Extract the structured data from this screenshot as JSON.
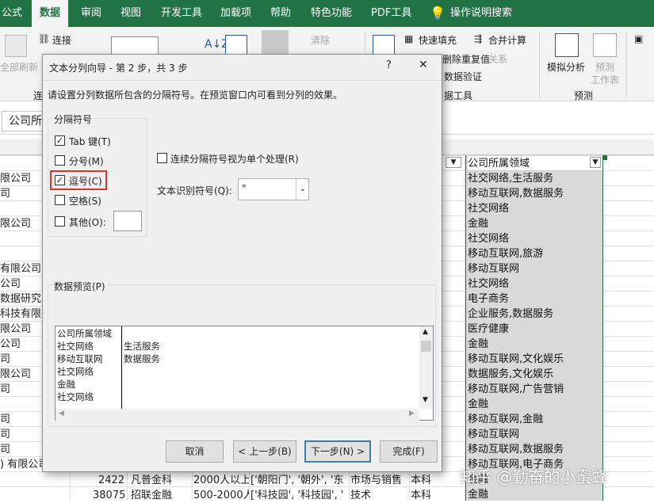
{
  "ribbon_tabs": [
    "公式",
    "数据",
    "审阅",
    "视图",
    "开发工具",
    "加载项",
    "帮助",
    "特色功能",
    "PDF工具",
    "操作说明搜索"
  ],
  "ribbon": {
    "connections": "连接",
    "refresh_all": "全部刷新",
    "clear": "清除",
    "flash_fill": "快速填充",
    "consolidate": "合并计算",
    "remove_dup": "删除重复值",
    "relations": "关系",
    "validate": "数据验证",
    "what_if": "模拟分析",
    "forecast_sheet": "预测\n工作表",
    "group_data_tools": "数据工具",
    "group_forecast": "预测",
    "group_conn_partial": "连",
    "group_tools_partial": "据工具"
  },
  "namebox": "公司所",
  "dialog": {
    "title": "文本分列向导 - 第 2 步，共 3 步",
    "help": "?",
    "close": "✕",
    "instruction": "请设置分列数据所包含的分隔符号。在预览窗口内可看到分列的效果。",
    "delimiters_label": "分隔符号",
    "opt_tab": "Tab 键(T)",
    "opt_semicolon": "分号(M)",
    "opt_comma": "逗号(C)",
    "opt_space": "空格(S)",
    "opt_other": "其他(O):",
    "consecutive": "连续分隔符号视为单个处理(R)",
    "text_qualifier_label": "文本识别符号(Q):",
    "text_qualifier_value": "\"",
    "preview_label": "数据预览(P)",
    "preview_rows": [
      [
        "公司所属领域",
        ""
      ],
      [
        "社交网络",
        "生活服务"
      ],
      [
        "移动互联网",
        "数据服务"
      ],
      [
        "社交网络",
        ""
      ],
      [
        "金融",
        ""
      ],
      [
        "社交网络",
        ""
      ]
    ],
    "btn_cancel": "取消",
    "btn_back": "< 上一步(B)",
    "btn_next": "下一步(N) >",
    "btn_finish": "完成(F)"
  },
  "sheet": {
    "column_header": "公司所属领域",
    "column_values": [
      "社交网络,生活服务",
      "移动互联网,数据服务",
      "社交网络",
      "金融",
      "社交网络",
      "移动互联网,旅游",
      "移动互联网",
      "社交网络",
      "电子商务",
      "企业服务,数据服务",
      "医疗健康",
      "金融",
      "移动互联网,文化娱乐",
      "数据服务,文化娱乐",
      "移动互联网,广告营销",
      "金融",
      "移动互联网,金融",
      "移动互联网",
      "移动互联网,数据服务",
      "移动互联网,电子商务",
      "金融",
      "金融"
    ],
    "left_fragments": [
      "限公司",
      "司",
      "",
      "限公司",
      "",
      "",
      "有限公司",
      "公司",
      "数据研究",
      "科技有限",
      "限公司",
      "公司",
      "司",
      "限公司",
      "司",
      "",
      "司",
      "司",
      "司",
      ") 有限公司",
      ""
    ],
    "row_last1": [
      "2422",
      "凡普金科",
      "2000人以上",
      "['朝阳门', '朝外', '东",
      "市场与销售",
      "本科"
    ],
    "row_last2": [
      "38075",
      "招联金融",
      "500-2000人",
      "['科技园', '科技园', '",
      "技术",
      "本科"
    ]
  },
  "watermark": "知乎 @勤奋的小蜜蜂"
}
